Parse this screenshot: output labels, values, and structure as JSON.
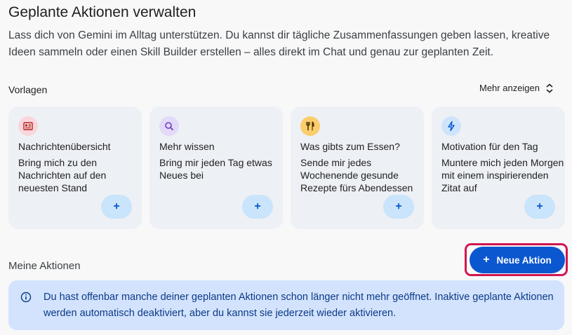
{
  "page": {
    "title": "Geplante Aktionen verwalten",
    "description": "Lass dich von Gemini im Alltag unterstützen. Du kannst dir tägliche Zusammenfassungen geben lassen, kreative Ideen sammeln oder einen Skill Builder erstellen – alles direkt im Chat und genau zur geplanten Zeit."
  },
  "templates": {
    "label": "Vorlagen",
    "more_label": "Mehr anzeigen",
    "cards": [
      {
        "icon": "newspaper-icon",
        "icon_bg": "#f9d6dd",
        "icon_color": "#b3261e",
        "title": "Nachrichtenübersicht",
        "text": "Bring mich zu den Nachrichten auf den neuesten Stand",
        "add_label": "+"
      },
      {
        "icon": "search-icon",
        "icon_bg": "#e3d9f8",
        "icon_color": "#6a3fc1",
        "title": "Mehr wissen",
        "text": "Bring mir jeden Tag etwas Neues bei",
        "add_label": "+"
      },
      {
        "icon": "cutlery-icon",
        "icon_bg": "#fbcd6c",
        "icon_color": "#4a3300",
        "title": "Was gibts zum Essen?",
        "text": "Sende mir jedes Wochenende gesunde Rezepte fürs Abendessen",
        "add_label": "+"
      },
      {
        "icon": "bolt-icon",
        "icon_bg": "#cfe4fb",
        "icon_color": "#0b57d0",
        "title": "Motivation für den Tag",
        "text": "Muntere mich jeden Morgen mit einem inspirierenden Zitat auf",
        "add_label": "+"
      }
    ]
  },
  "my_actions": {
    "label": "Meine Aktionen",
    "new_button_icon": "+",
    "new_button_label": "Neue Aktion"
  },
  "banner": {
    "icon": "info-icon",
    "text": "Du hast offenbar manche deiner geplanten Aktionen schon länger nicht mehr geöffnet. Inaktive geplante Aktionen werden automatisch deaktiviert, aber du kannst sie jederzeit wieder aktivieren."
  },
  "colors": {
    "accent": "#0b57d0",
    "highlight": "#d2164e",
    "banner_bg": "#d3e3fd"
  }
}
